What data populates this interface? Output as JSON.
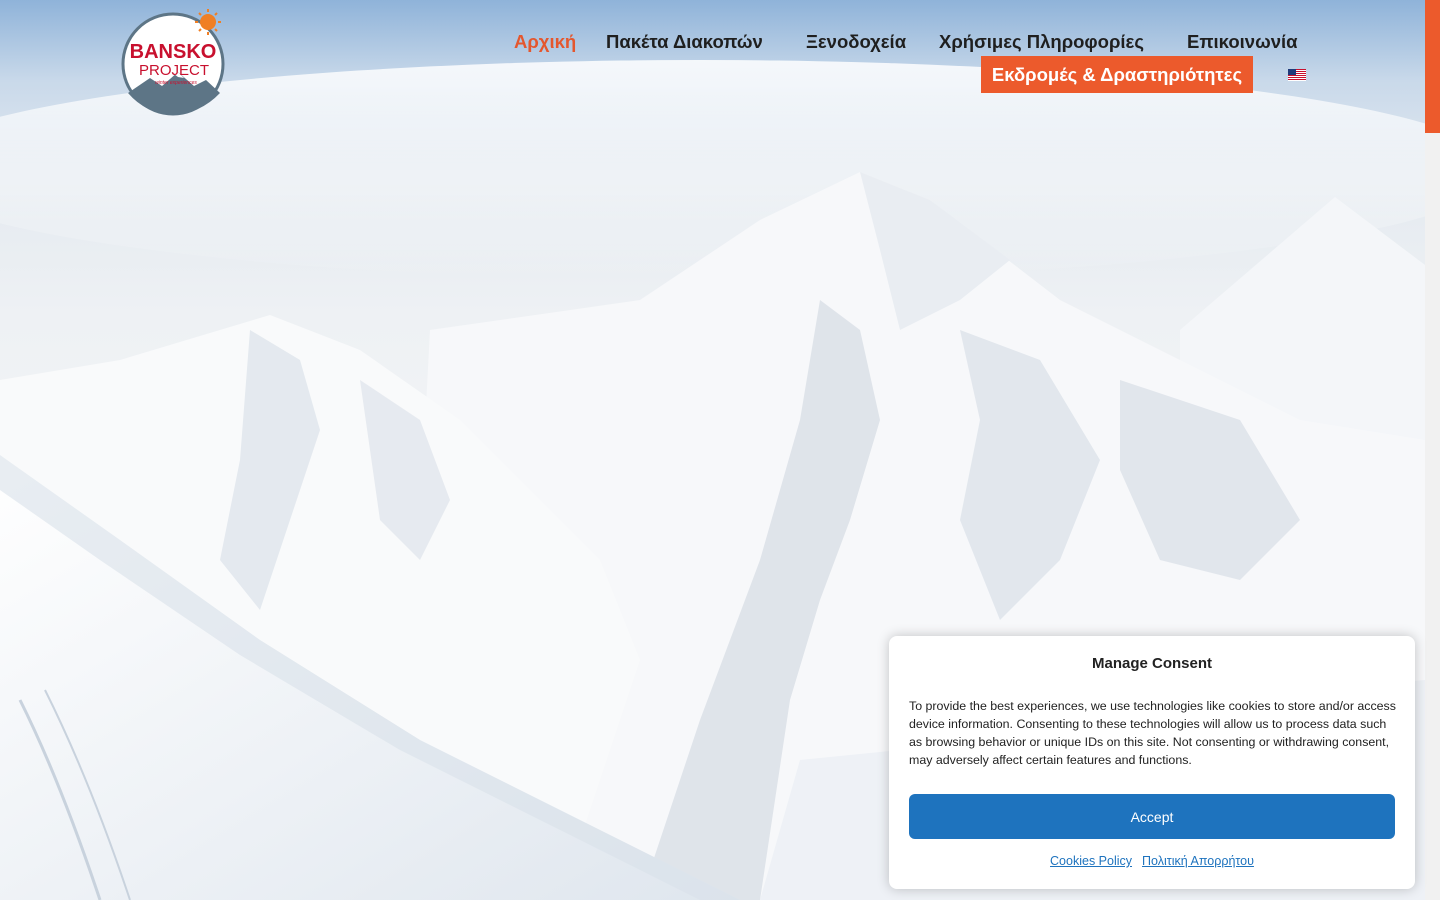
{
  "header": {
    "logo": {
      "title": "BANSKO",
      "subtitle": "PROJECT",
      "tagline": "winter experiences"
    },
    "nav": [
      {
        "label": "Αρχική",
        "active": true
      },
      {
        "label": "Πακέτα Διακοπών",
        "active": false
      },
      {
        "label": "Ξενοδοχεία",
        "active": false
      },
      {
        "label": "Χρήσιμες Πληροφορίες",
        "active": false
      },
      {
        "label": "Επικοινωνία",
        "active": false
      }
    ],
    "cta_label": "Εκδρομές & Δραστηριότητες",
    "language_icon": "us-flag-icon"
  },
  "consent": {
    "title": "Manage Consent",
    "text": "To provide the best experiences, we use technologies like cookies to store and/or access device information. Consenting to these technologies will allow us to process data such as browsing behavior or unique IDs on this site. Not consenting or withdrawing consent, may adversely affect certain features and functions.",
    "accept_label": "Accept",
    "links": [
      "Cookies Policy",
      "Πολιτική Απορρήτου"
    ]
  },
  "colors": {
    "accent": "#ec5a2c",
    "primary_button": "#1e73be",
    "active_nav": "#e4572e"
  }
}
